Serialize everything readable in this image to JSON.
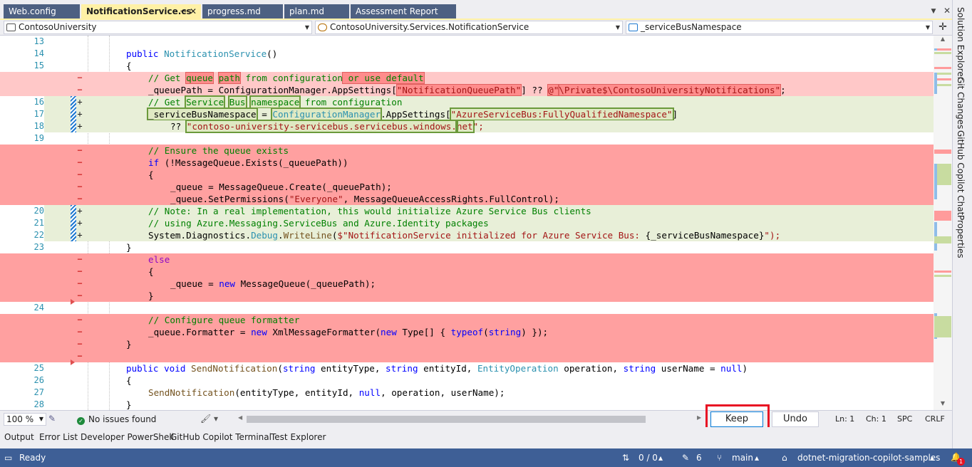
{
  "tabs": [
    {
      "label": "Web.config",
      "active": false
    },
    {
      "label": "NotificationService.cs",
      "active": true
    },
    {
      "label": "progress.md",
      "active": false
    },
    {
      "label": "plan.md",
      "active": false
    },
    {
      "label": "Assessment Report",
      "active": false
    }
  ],
  "nav": {
    "project": "ContosoUniversity",
    "type": "ContosoUniversity.Services.NotificationService",
    "member": "_serviceBusNamespace"
  },
  "code_lines": [
    {
      "num": "13",
      "kind": "ctx",
      "marker": ""
    },
    {
      "num": "14",
      "kind": "ctx",
      "marker": ""
    },
    {
      "num": "15",
      "kind": "ctx",
      "marker": ""
    },
    {
      "num": "",
      "kind": "del",
      "marker": "−"
    },
    {
      "num": "",
      "kind": "del",
      "marker": "−"
    },
    {
      "num": "16",
      "kind": "add",
      "marker": "+"
    },
    {
      "num": "17",
      "kind": "add",
      "marker": "+"
    },
    {
      "num": "18",
      "kind": "add",
      "marker": "+"
    },
    {
      "num": "19",
      "kind": "ctx",
      "marker": ""
    },
    {
      "num": "",
      "kind": "bdel",
      "marker": "−"
    },
    {
      "num": "",
      "kind": "bdel",
      "marker": "−"
    },
    {
      "num": "",
      "kind": "bdel",
      "marker": "−"
    },
    {
      "num": "",
      "kind": "bdel",
      "marker": "−"
    },
    {
      "num": "",
      "kind": "bdel",
      "marker": "−"
    },
    {
      "num": "20",
      "kind": "add",
      "marker": "+"
    },
    {
      "num": "21",
      "kind": "add",
      "marker": "+"
    },
    {
      "num": "22",
      "kind": "add",
      "marker": "+"
    },
    {
      "num": "23",
      "kind": "ctx",
      "marker": ""
    },
    {
      "num": "",
      "kind": "bdel",
      "marker": "−"
    },
    {
      "num": "",
      "kind": "bdel",
      "marker": "−"
    },
    {
      "num": "",
      "kind": "bdel",
      "marker": "−"
    },
    {
      "num": "",
      "kind": "bdel",
      "marker": "−"
    },
    {
      "num": "24",
      "kind": "ctx",
      "marker": ""
    },
    {
      "num": "",
      "kind": "bdel",
      "marker": "−"
    },
    {
      "num": "",
      "kind": "bdel",
      "marker": "−"
    },
    {
      "num": "",
      "kind": "bdel",
      "marker": "−"
    },
    {
      "num": "",
      "kind": "bdel",
      "marker": "−"
    },
    {
      "num": "25",
      "kind": "ctx",
      "marker": ""
    },
    {
      "num": "26",
      "kind": "ctx",
      "marker": ""
    },
    {
      "num": "27",
      "kind": "ctx",
      "marker": ""
    },
    {
      "num": "28",
      "kind": "ctx",
      "marker": ""
    }
  ],
  "code_text": {
    "l1": "",
    "l2_k": "public",
    "l2_t": "NotificationService",
    "l2_r": "()",
    "l3": "{",
    "l4_c1": "// Get ",
    "l4_c2": "queue",
    "l4_c3": " ",
    "l4_c4": "path",
    "l4_c5": " from configuration",
    "l4_c6": " or use default",
    "l5_a": "_queuePath",
    "l5_b": " = ConfigurationManager.AppSettings[",
    "l5_s": "\"NotificationQueuePath\"",
    "l5_c": "]",
    "l5_d": " ?? ",
    "l5_e": "@\"",
    "l5_f": "\\Private$\\ContosoUniversityNotifications\"",
    "l5_g": ";",
    "l6_c1": "// Get ",
    "l6_c2": "Service",
    "l6_c3": " ",
    "l6_c4": "Bus",
    "l6_c5": " ",
    "l6_c6": "namespace",
    "l6_c7": " from configuration",
    "l7_a": "_serviceBusNamespace",
    "l7_b": " = ",
    "l7_t": "ConfigurationManager",
    "l7_c": ".AppSettings[",
    "l7_s": "\"AzureServiceBus:FullyQualifiedNamespace\"",
    "l7_d": "]",
    "l8_a": "?? ",
    "l8_s": "\"contoso-university-servicebus.servicebus.windows.",
    "l8_n": "net",
    "l8_e": "\";",
    "l10": "// Ensure the queue exists",
    "l11_k": "if",
    "l11_r": " (!MessageQueue.Exists(_queuePath))",
    "l12": "{",
    "l13": "_queue = MessageQueue.Create(_queuePath);",
    "l14_a": "_queue.SetPermissions(",
    "l14_s": "\"Everyone\"",
    "l14_b": ", MessageQueueAccessRights.FullControl);",
    "l15": "// Note: In a real implementation, this would initialize Azure Service Bus clients",
    "l16": "// using Azure.Messaging.ServiceBus and Azure.Identity packages",
    "l17_a": "System.Diagnostics.",
    "l17_t": "Debug",
    "l17_b": ".",
    "l17_m": "WriteLine",
    "l17_c": "(",
    "l17_s": "$\"NotificationService initialized for Azure Service Bus: ",
    "l17_d": "{_serviceBusNamespace}",
    "l17_e": "\");",
    "l18": "}",
    "l19_k": "else",
    "l20": "{",
    "l21_a": "_queue = ",
    "l21_k": "new",
    "l21_b": " MessageQueue(_queuePath);",
    "l22": "}",
    "l24": "// Configure queue formatter",
    "l25_a": "_queue.Formatter = ",
    "l25_k": "new",
    "l25_b": " XmlMessageFormatter(",
    "l25_k2": "new",
    "l25_c": " Type[] { ",
    "l25_k3": "typeof",
    "l25_d": "(",
    "l25_k4": "string",
    "l25_e": ") });",
    "l26": "}",
    "l28_k": "public",
    "l28_k2": "void",
    "l28_m": "SendNotification",
    "l28_a": "(",
    "l28_k3": "string",
    "l28_b": " entityType, ",
    "l28_k4": "string",
    "l28_c": " entityId, ",
    "l28_t": "EntityOperation",
    "l28_d": " operation, ",
    "l28_k5": "string",
    "l28_e": " userName = ",
    "l28_k6": "null",
    "l28_f": ")",
    "l29": "{",
    "l30_m": "SendNotification",
    "l30_a": "(entityType, entityId, ",
    "l30_k": "null",
    "l30_b": ", operation, userName);",
    "l31": "}"
  },
  "right_tabs": [
    "Solution Explorer",
    "Git Changes",
    "GitHub Copilot Chat",
    "Properties"
  ],
  "editor_status": {
    "zoom": "100 %",
    "issues": "No issues found",
    "keep_label": "Keep",
    "undo_label": "Undo",
    "ln": "Ln: 1",
    "ch": "Ch: 1",
    "spc": "SPC",
    "eol": "CRLF"
  },
  "tool_tabs": [
    "Output",
    "Error List",
    "Developer PowerShell",
    "GitHub Copilot Terminal",
    "Test Explorer"
  ],
  "status": {
    "ready": "Ready",
    "commits": "0 / 0",
    "changes": "6",
    "branch": "main",
    "repo": "dotnet-migration-copilot-samples",
    "notifications": "1"
  },
  "colors": {
    "accent_tab": "#fff1a6",
    "tab_inactive": "#4d6082",
    "status_bar": "#3e5f96",
    "deleted_line": "#ffa0a0",
    "added_line": "#e8efd8",
    "highlight_box": "#e81123"
  }
}
